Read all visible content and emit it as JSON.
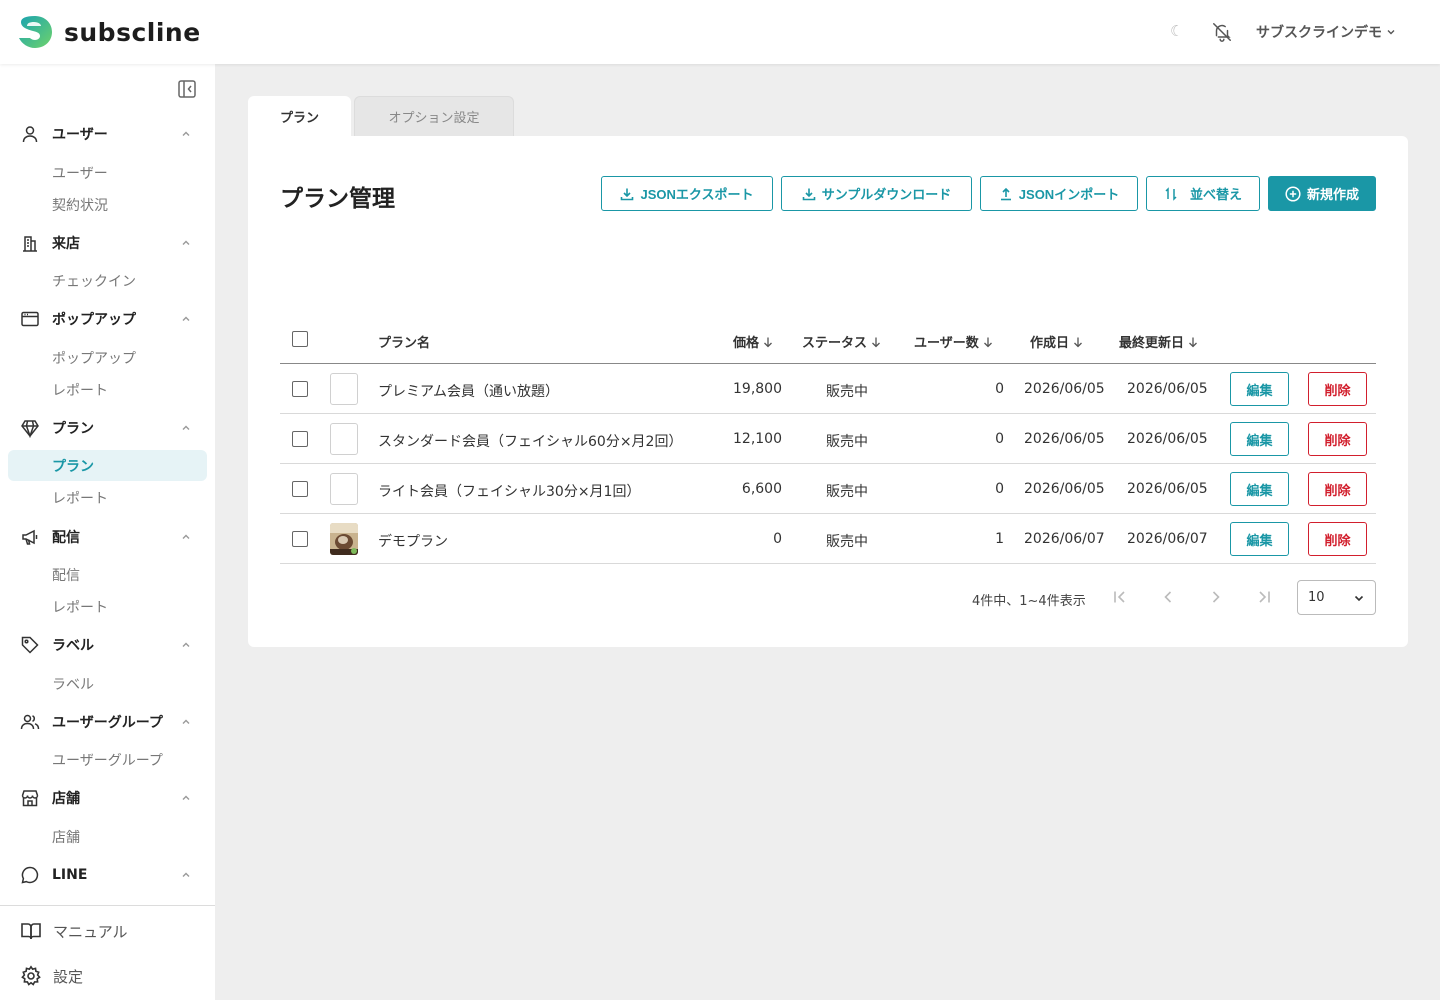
{
  "header": {
    "brand": "subscline",
    "account": "サブスクラインデモ"
  },
  "sidebar": {
    "groups": [
      {
        "label": "ユーザー",
        "items": [
          "ユーザー",
          "契約状況"
        ]
      },
      {
        "label": "来店",
        "items": [
          "チェックイン"
        ]
      },
      {
        "label": "ポップアップ",
        "items": [
          "ポップアップ",
          "レポート"
        ]
      },
      {
        "label": "プラン",
        "items": [
          "プラン",
          "レポート"
        ]
      },
      {
        "label": "配信",
        "items": [
          "配信",
          "レポート"
        ]
      },
      {
        "label": "ラベル",
        "items": [
          "ラベル"
        ]
      },
      {
        "label": "ユーザーグループ",
        "items": [
          "ユーザーグループ"
        ]
      },
      {
        "label": "店舗",
        "items": [
          "店舗"
        ]
      },
      {
        "label": "LINE",
        "items": []
      }
    ],
    "bottom": [
      "マニュアル",
      "設定"
    ],
    "active_item": "プラン"
  },
  "tabs": [
    "プラン",
    "オプション設定"
  ],
  "page": {
    "title": "プラン管理",
    "toolbar": [
      "JSONエクスポート",
      "サンプルダウンロード",
      "JSONインポート",
      "並べ替え",
      "新規作成"
    ]
  },
  "table": {
    "columns": [
      "プラン名",
      "価格",
      "ステータス",
      "ユーザー数",
      "作成日",
      "最終更新日"
    ],
    "rows": [
      {
        "name": "プレミアム会員（通い放題）",
        "price": "19,800",
        "status": "販売中",
        "users": "0",
        "created": "2026/06/05",
        "updated": "2026/06/05"
      },
      {
        "name": "スタンダード会員（フェイシャル60分×月2回）",
        "price": "12,100",
        "status": "販売中",
        "users": "0",
        "created": "2026/06/05",
        "updated": "2026/06/05"
      },
      {
        "name": "ライト会員（フェイシャル30分×月1回）",
        "price": "6,600",
        "status": "販売中",
        "users": "0",
        "created": "2026/06/05",
        "updated": "2026/06/05"
      },
      {
        "name": "デモプラン",
        "price": "0",
        "status": "販売中",
        "users": "1",
        "created": "2026/06/07",
        "updated": "2026/06/07"
      }
    ],
    "edit_label": "編集",
    "delete_label": "削除"
  },
  "pagination": {
    "summary": "4件中、1~4件表示",
    "page_size": "10"
  },
  "colors": {
    "accent": "#1a97a6",
    "danger": "#d21f2d",
    "active_bg": "#e6f3f6"
  }
}
